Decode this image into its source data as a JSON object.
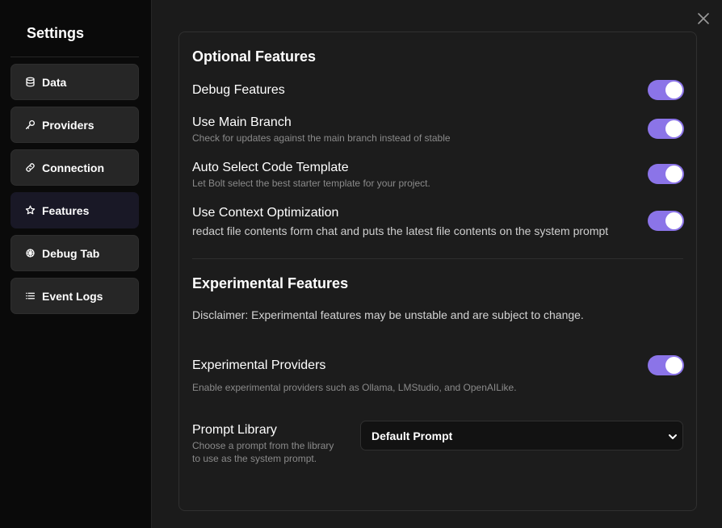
{
  "sidebar": {
    "title": "Settings",
    "items": [
      {
        "label": "Data",
        "icon": "database-icon"
      },
      {
        "label": "Providers",
        "icon": "key-icon"
      },
      {
        "label": "Connection",
        "icon": "link-icon"
      },
      {
        "label": "Features",
        "icon": "star-icon",
        "active": true
      },
      {
        "label": "Debug Tab",
        "icon": "bug-icon"
      },
      {
        "label": "Event Logs",
        "icon": "list-icon"
      }
    ]
  },
  "optional": {
    "title": "Optional Features",
    "debug": {
      "label": "Debug Features",
      "enabled": true
    },
    "main_branch": {
      "label": "Use Main Branch",
      "desc": "Check for updates against the main branch instead of stable",
      "enabled": true
    },
    "auto_template": {
      "label": "Auto Select Code Template",
      "desc": "Let Bolt select the best starter template for your project.",
      "enabled": true
    },
    "context_opt": {
      "label": "Use Context Optimization",
      "desc": "redact file contents form chat and puts the latest file contents on the system prompt",
      "enabled": true
    }
  },
  "experimental": {
    "title": "Experimental Features",
    "disclaimer": "Disclaimer: Experimental features may be unstable and are subject to change.",
    "providers": {
      "label": "Experimental Providers",
      "desc": "Enable experimental providers such as Ollama, LMStudio, and OpenAILike.",
      "enabled": true
    },
    "prompt_library": {
      "label": "Prompt Library",
      "desc_line1": "Choose a prompt from the library",
      "desc_line2": "to use as the system prompt.",
      "selected": "Default Prompt"
    }
  },
  "colors": {
    "accent": "#8b74e8",
    "background": "#1b1b1b",
    "sidebar": "#0a0a0a"
  }
}
